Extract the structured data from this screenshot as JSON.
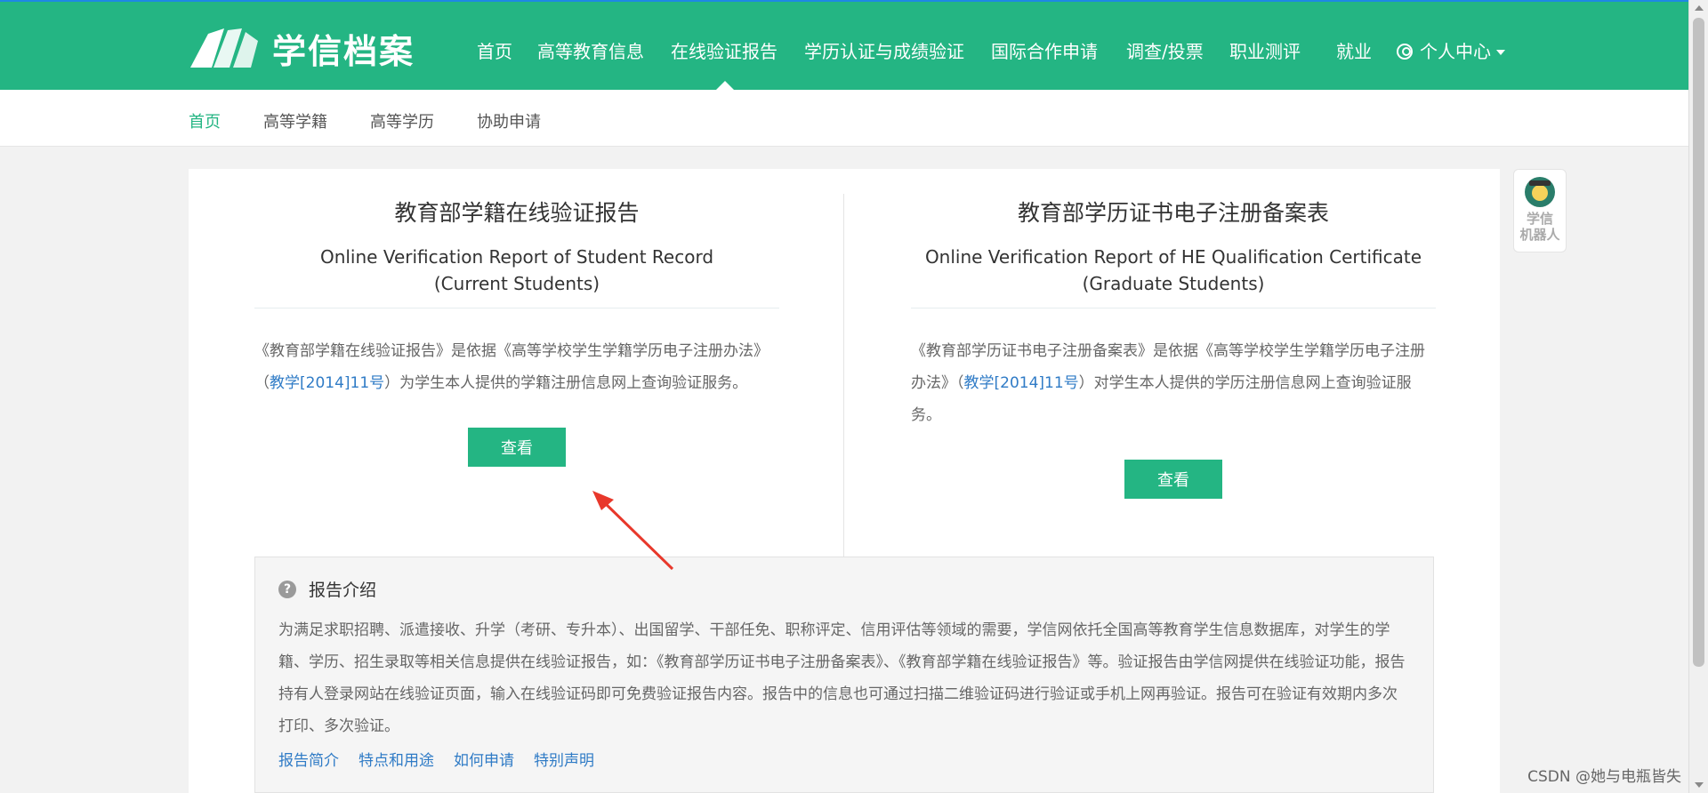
{
  "header": {
    "logo_text": "学信档案",
    "nav": [
      {
        "label": "首页"
      },
      {
        "label": "高等教育信息"
      },
      {
        "label": "在线验证报告"
      },
      {
        "label": "学历认证与成绩验证"
      },
      {
        "label": "国际合作申请"
      },
      {
        "label": "调查/投票"
      },
      {
        "label": "职业测评"
      },
      {
        "label": "就业"
      }
    ],
    "user_menu": "个人中心",
    "brand_color": "#24b583"
  },
  "subnav": {
    "items": [
      {
        "label": "首页",
        "active": true
      },
      {
        "label": "高等学籍"
      },
      {
        "label": "高等学历"
      },
      {
        "label": "协助申请"
      }
    ]
  },
  "cards": {
    "left": {
      "title": "教育部学籍在线验证报告",
      "en_line1": "Online Verification Report of Student Record",
      "en_line2": "(Current Students)",
      "desc_pre": "《教育部学籍在线验证报告》是依据《高等学校学生学籍学历电子注册办法》（",
      "desc_link": "教学[2014]11号",
      "desc_post": "）为学生本人提供的学籍注册信息网上查询验证服务。",
      "button": "查看"
    },
    "right": {
      "title": "教育部学历证书电子注册备案表",
      "en_line1": "Online Verification Report of HE Qualification Certificate",
      "en_line2": "(Graduate Students)",
      "desc_pre": "《教育部学历证书电子注册备案表》是依据《高等学校学生学籍学历电子注册办法》（",
      "desc_link": "教学[2014]11号",
      "desc_post": "）对学生本人提供的学历注册信息网上查询验证服务。",
      "button": "查看"
    }
  },
  "intro": {
    "title": "报告介绍",
    "body": "为满足求职招聘、派遣接收、升学（考研、专升本）、出国留学、干部任免、职称评定、信用评估等领域的需要，学信网依托全国高等教育学生信息数据库，对学生的学籍、学历、招生录取等相关信息提供在线验证报告，如：《教育部学历证书电子注册备案表》、《教育部学籍在线验证报告》等。验证报告由学信网提供在线验证功能，报告持有人登录网站在线验证页面，输入在线验证码即可免费验证报告内容。报告中的信息也可通过扫描二维验证码进行验证或手机上网再验证。报告可在验证有效期内多次打印、多次验证。",
    "links": [
      {
        "label": "报告简介"
      },
      {
        "label": "特点和用途"
      },
      {
        "label": "如何申请"
      },
      {
        "label": "特别声明"
      }
    ]
  },
  "robot": {
    "line1": "学信",
    "line2": "机器人"
  },
  "watermark": "CSDN @她与电瓶皆失"
}
